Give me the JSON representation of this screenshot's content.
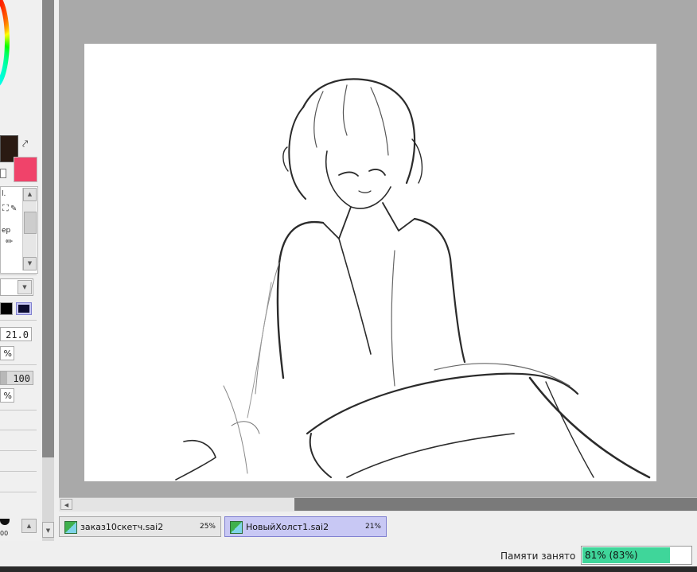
{
  "colors": {
    "foreground": "#2a1a12",
    "background": "#f0436a",
    "canvas_bg": "#a9a9a9",
    "memory_fill": "#3fd69a",
    "active_tab": "#c8c8f4"
  },
  "tool_panel": {
    "tool_text_1": "l.",
    "tool_text_2": "ep",
    "brush_size": "21.0",
    "min_size_pct": "%",
    "density": "100",
    "density_pct": "%",
    "brush_preview_label": "00"
  },
  "documents": [
    {
      "name": "заказ10скетч.sai2",
      "zoom": "25%",
      "active": false
    },
    {
      "name": "НовыйХолст1.sai2",
      "zoom": "21%",
      "active": true
    }
  ],
  "status": {
    "memory_label": "Памяти занято",
    "memory_value": "81% (83%)",
    "memory_fraction": 0.81
  }
}
